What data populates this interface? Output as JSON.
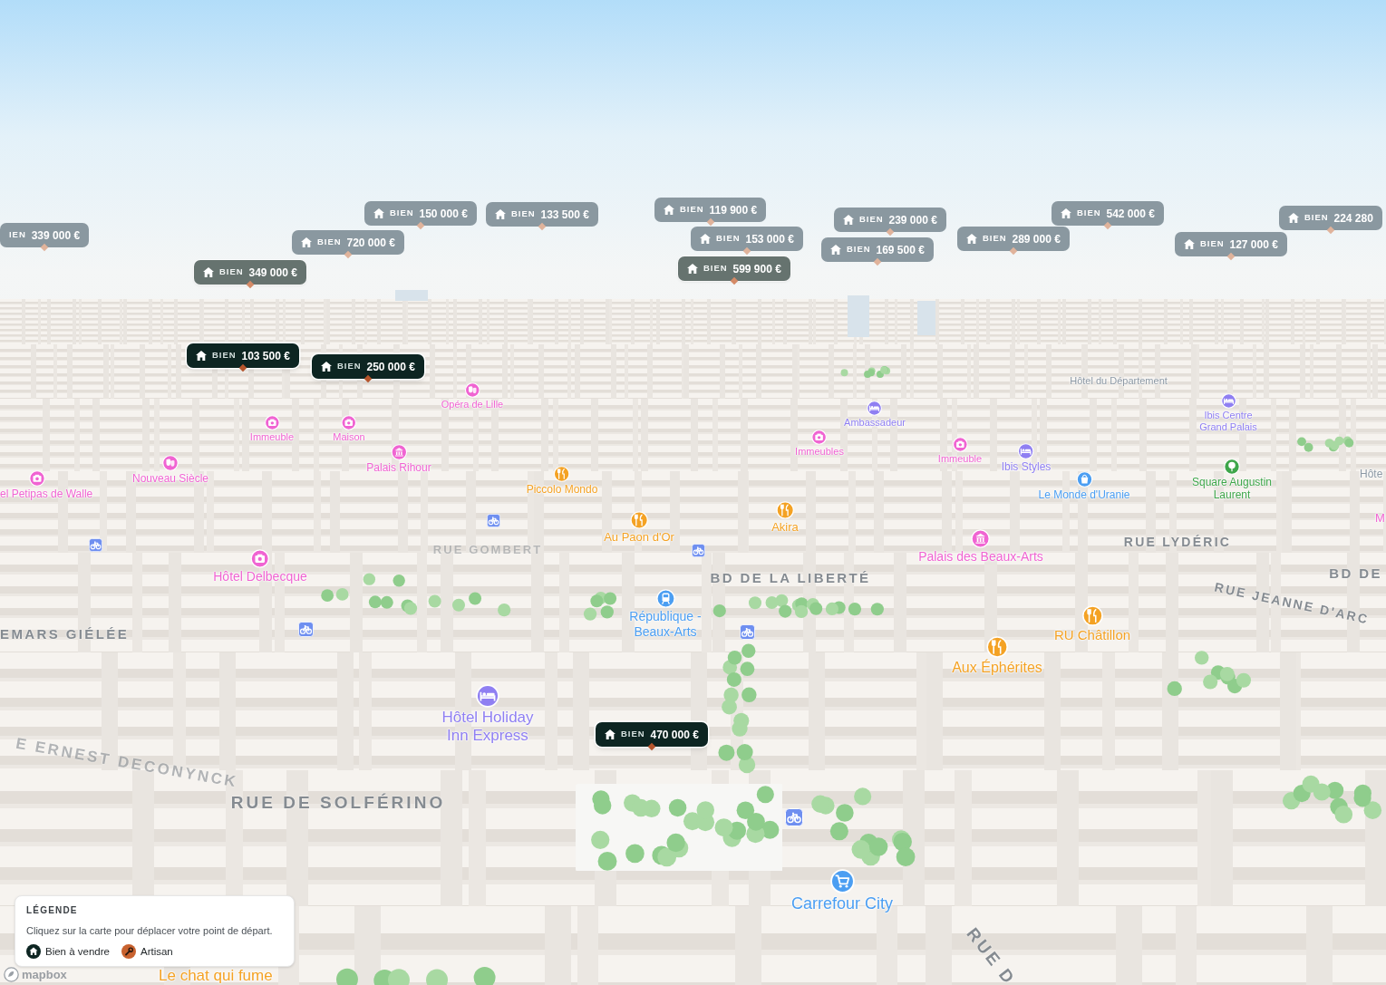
{
  "map": {
    "price_markers": [
      {
        "label": "BIEN",
        "price": "150 000 €",
        "kind": "far",
        "house_icon": true
      },
      {
        "label": "BIEN",
        "price": "133 500 €",
        "kind": "far",
        "house_icon": true
      },
      {
        "label": "BIEN",
        "price": "119 900 €",
        "kind": "far",
        "house_icon": true
      },
      {
        "label": "BIEN",
        "price": "239 000 €",
        "kind": "far",
        "house_icon": true
      },
      {
        "label": "BIEN",
        "price": "542 000 €",
        "kind": "far",
        "house_icon": true
      },
      {
        "label": "BIEN",
        "price": "224 280",
        "kind": "far",
        "house_icon": true
      },
      {
        "label": "IEN",
        "price": "339 000 €",
        "kind": "far",
        "house_icon": false
      },
      {
        "label": "BIEN",
        "price": "720 000 €",
        "kind": "far",
        "house_icon": true
      },
      {
        "label": "BIEN",
        "price": "153 000 €",
        "kind": "far",
        "house_icon": true
      },
      {
        "label": "BIEN",
        "price": "169 500 €",
        "kind": "far",
        "house_icon": true
      },
      {
        "label": "BIEN",
        "price": "289 000 €",
        "kind": "far",
        "house_icon": true
      },
      {
        "label": "BIEN",
        "price": "127 000 €",
        "kind": "far",
        "house_icon": true
      },
      {
        "label": "BIEN",
        "price": "349 000 €",
        "kind": "mid",
        "house_icon": true
      },
      {
        "label": "BIEN",
        "price": "599 900 €",
        "kind": "mid",
        "house_icon": true
      },
      {
        "label": "BIEN",
        "price": "103 500 €",
        "kind": "near",
        "house_icon": true
      },
      {
        "label": "BIEN",
        "price": "250 000 €",
        "kind": "near",
        "house_icon": true
      },
      {
        "label": "BIEN",
        "price": "470 000 €",
        "kind": "near",
        "house_icon": true
      }
    ],
    "places": [
      {
        "name": "Hôtel du Département",
        "kind": "label",
        "color": "#8c98a4"
      },
      {
        "name": "Opéra de Lille",
        "kind": "theatre",
        "color": "#f064d2"
      },
      {
        "name": "Ambassadeur",
        "kind": "hotel",
        "color": "#8f7ff2"
      },
      {
        "name": "Ibis Centre Grand Palais",
        "kind": "hotel",
        "color": "#8f7ff2"
      },
      {
        "name": "Immeuble",
        "kind": "landmark",
        "color": "#f064d2"
      },
      {
        "name": "Maison",
        "kind": "landmark",
        "color": "#f064d2"
      },
      {
        "name": "Immeubles",
        "kind": "landmark",
        "color": "#f064d2"
      },
      {
        "name": "Immeuble",
        "kind": "landmark",
        "color": "#f064d2"
      },
      {
        "name": "Palais Rihour",
        "kind": "monument",
        "color": "#f064d2"
      },
      {
        "name": "Ibis Styles",
        "kind": "hotel",
        "color": "#8f7ff2"
      },
      {
        "name": "Nouveau Siècle",
        "kind": "theatre",
        "color": "#f064d2"
      },
      {
        "name": "Hôte",
        "kind": "label",
        "color": "#8c98a4"
      },
      {
        "name": "el Petipas de Walle",
        "kind": "landmark",
        "color": "#f064d2"
      },
      {
        "name": "Piccolo Mondo",
        "kind": "restaurant",
        "color": "#f4a224"
      },
      {
        "name": "Le Monde d'Uranie",
        "kind": "shop",
        "color": "#4b9ef2"
      },
      {
        "name": "Square Augustin Laurent",
        "kind": "park",
        "color": "#3ea64a"
      },
      {
        "name": "Akira",
        "kind": "restaurant",
        "color": "#f4a224"
      },
      {
        "name": "M",
        "kind": "label",
        "color": "#f064d2"
      },
      {
        "name": "Au Paon d'Or",
        "kind": "restaurant",
        "color": "#f4a224"
      },
      {
        "name": "Palais des Beaux-Arts",
        "kind": "monument",
        "color": "#f064d2"
      },
      {
        "name": "Hôtel Delbecque",
        "kind": "landmark",
        "color": "#f064d2"
      },
      {
        "name": "République - Beaux-Arts",
        "kind": "station",
        "color": "#4b9ef2"
      },
      {
        "name": "RU Châtillon",
        "kind": "restaurant",
        "color": "#f4a224"
      },
      {
        "name": "Aux Éphérites",
        "kind": "restaurant",
        "color": "#f4a224"
      },
      {
        "name": "Hôtel Holiday Inn Express",
        "kind": "hotel",
        "color": "#8f7ff2"
      },
      {
        "name": "Carrefour City",
        "kind": "supermarket",
        "color": "#4b9ef2"
      },
      {
        "name": "Le chat qui fume",
        "kind": "label",
        "color": "#f4a224"
      }
    ],
    "streets": [
      "RUE GOMBERT",
      "BD DE LA LIBERTÉ",
      "RUE LYDÉRIC",
      "BD DE",
      "RUE JEANNE D'ARC",
      "EMARS GIÉLÉE",
      "E ERNEST DECONYNCK",
      "RUE DE SOLFÉRINO",
      "RUE D"
    ],
    "attribution": {
      "logo_text": "mapbox"
    }
  },
  "legend": {
    "title": "LÉGENDE",
    "hint": "Cliquez sur la carte pour déplacer votre point de départ.",
    "items": [
      {
        "label": "Bien à vendre",
        "kind": "property",
        "color": "#0d2522"
      },
      {
        "label": "Artisan",
        "kind": "artisan",
        "color": "#c8622f"
      }
    ]
  }
}
